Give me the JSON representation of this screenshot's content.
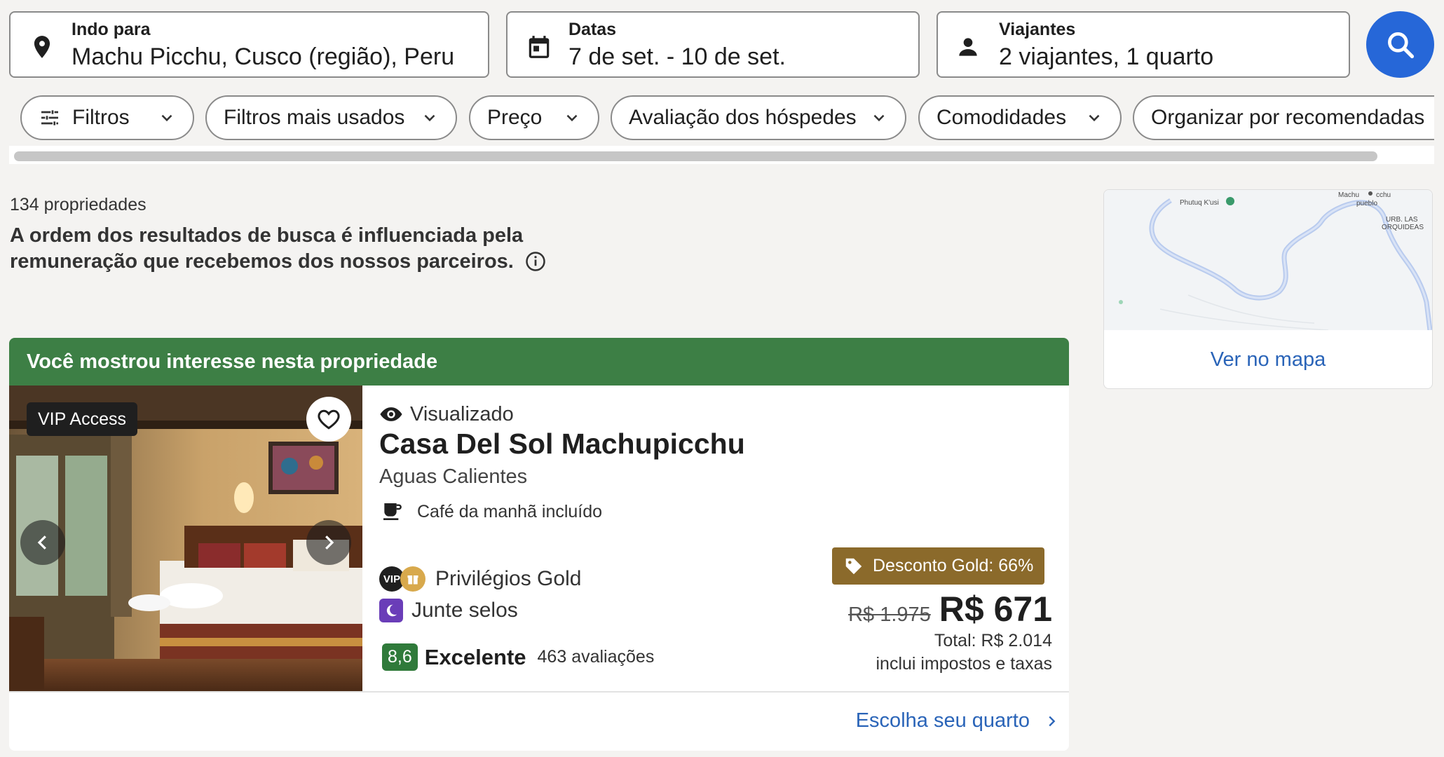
{
  "search": {
    "destination": {
      "label": "Indo para",
      "value": "Machu Picchu, Cusco (região), Peru",
      "icon": "location-pin-icon"
    },
    "dates": {
      "label": "Datas",
      "value": "7 de set. - 10 de set.",
      "icon": "calendar-icon"
    },
    "travelers": {
      "label": "Viajantes",
      "value": "2 viajantes, 1 quarto",
      "icon": "person-icon"
    },
    "button_icon": "search-icon"
  },
  "filters": [
    {
      "label": "Filtros"
    },
    {
      "label": "Filtros mais usados"
    },
    {
      "label": "Preço"
    },
    {
      "label": "Avaliação dos hóspedes"
    },
    {
      "label": "Comodidades"
    },
    {
      "label": "Organizar por recomendadas"
    }
  ],
  "results": {
    "count": "134 propriedades",
    "disclaimer": "A ordem dos resultados de busca é influenciada pela remuneração que recebemos dos nossos parceiros."
  },
  "map": {
    "link": "Ver no mapa",
    "labels": {
      "place1": "Phutuq K'usi",
      "place2": "Machu",
      "place3": "cchu",
      "place4": "pueblo",
      "place5": "URB. LAS",
      "place6": "ORQUIDEAS"
    }
  },
  "card": {
    "banner": "Você mostrou interesse nesta propriedade",
    "vip_badge": "VIP Access",
    "viewed": "Visualizado",
    "name": "Casa Del Sol Machupicchu",
    "location": "Aguas Calientes",
    "amenity": "Café da manhã incluído",
    "gold": "Privilégios Gold",
    "vip_short": "VIP",
    "stamps": "Junte selos",
    "score": "8,6",
    "rating_word": "Excelente",
    "reviews": "463 avaliações",
    "discount": "Desconto Gold: 66%",
    "old_price": "R$ 1.975",
    "new_price": "R$ 671",
    "total": "Total: R$ 2.014",
    "taxes": "inclui impostos e taxas",
    "cta": "Escolha seu quarto"
  },
  "colors": {
    "accent": "#2667d8",
    "banner": "#3d7f45",
    "discount": "#8b6a2b",
    "score": "#2f7a3a",
    "link": "#2a64b8"
  }
}
